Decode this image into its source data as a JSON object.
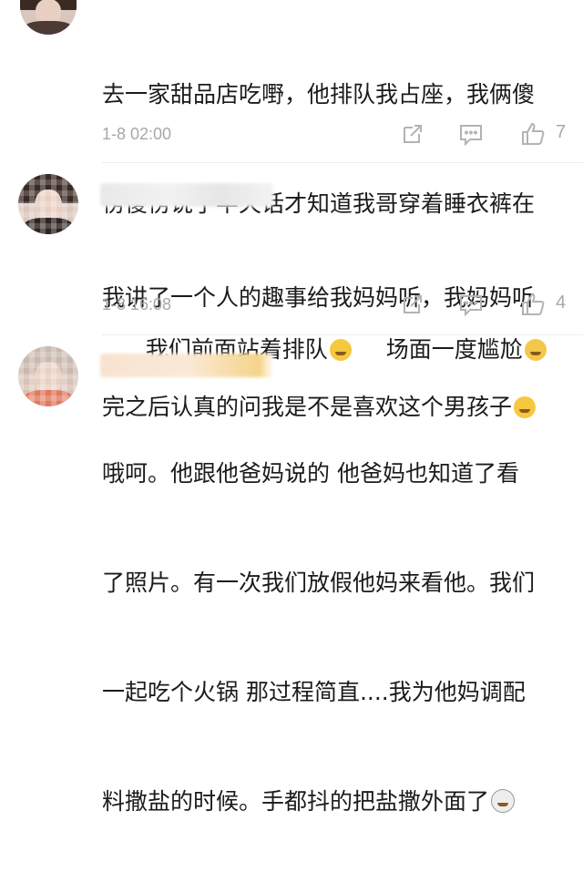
{
  "comments": [
    {
      "text_lines": [
        "去一家甜品店吃嘢，他排队我占座，我俩傻",
        "愣傻愣说了半天话才知道我哥穿着睡衣裤在",
        "我们前面站着排队"
      ],
      "tail_a": "场面一度尴尬",
      "time": "1-8 02:00",
      "likes": "7"
    },
    {
      "text_lines": [
        "我讲了一个人的趣事给我妈妈听，我妈妈听",
        "完之后认真的问我是不是喜欢这个男孩子"
      ],
      "time": "1-8 16:08",
      "likes": "4"
    },
    {
      "text_lines": [
        "哦呵。他跟他爸妈说的 他爸妈也知道了看",
        "了照片。有一次我们放假他妈来看他。我们",
        "一起吃个火锅 那过程简直....我为他妈调配",
        "料撒盐的时候。手都抖的把盐撒外面了"
      ]
    }
  ],
  "icons": {
    "share": "share-icon",
    "comment": "comment-icon",
    "like": "thumbs-up-icon",
    "emoji_smile": "smirk-emoji-icon",
    "emoji_sweat": "sweat-emoji-icon",
    "emoji_laugh": "laugh-cry-emoji-icon",
    "emoji_shock": "shocked-emoji-icon"
  },
  "colors": {
    "text": "#1b1b1b",
    "meta": "#a8a8a8",
    "emoji": "#f6c83e"
  }
}
